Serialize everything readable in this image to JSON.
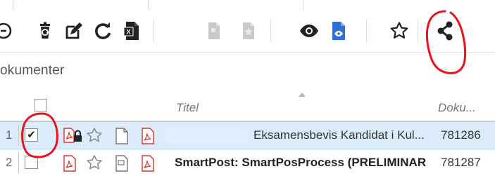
{
  "heading": "okumenter",
  "table": {
    "columns": {
      "title": "Titel",
      "doc": "Doku..."
    },
    "rows": [
      {
        "num": "1",
        "checked": "✔",
        "title": "Eksamensbevis Kandidat i Kul...",
        "doc_no": "781286"
      },
      {
        "num": "2",
        "checked": "",
        "title": "SmartPost: SmartPosProcess (PRELIMINAR",
        "doc_no": "781287"
      }
    ]
  },
  "toolbar": {
    "icons": [
      "partial-circle-icon",
      "recycle-bin-icon",
      "edit-icon",
      "refresh-icon",
      "excel-export-icon",
      "document-disabled-icon",
      "document-star-disabled-icon",
      "eye-icon",
      "document-eye-icon",
      "star-icon",
      "share-icon",
      "partial-icon"
    ]
  },
  "colors": {
    "accent": "#2f6fd6",
    "annotation": "#e8141c",
    "pdf": "#d9342b",
    "selected_row": "#dcecfb"
  }
}
